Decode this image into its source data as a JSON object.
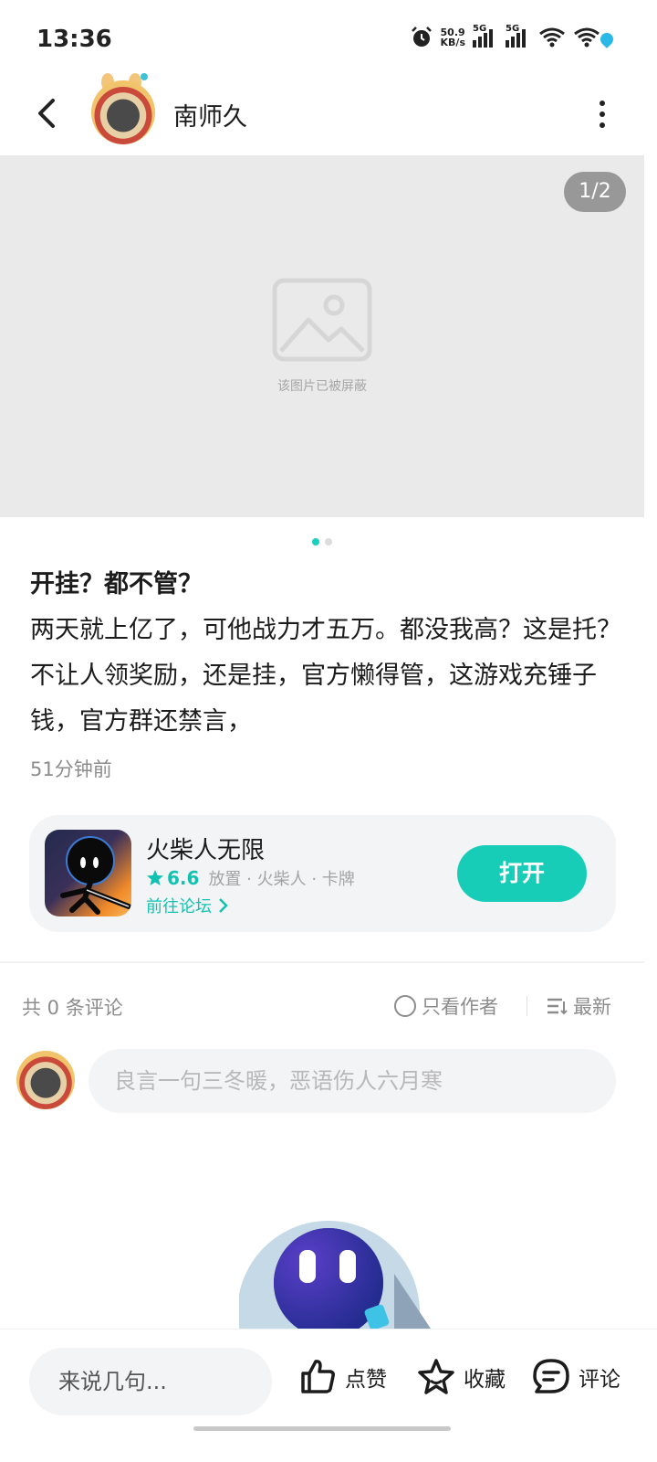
{
  "status_bar": {
    "time": "13:36",
    "net_speed_value": "50.9",
    "net_speed_unit": "KB/s",
    "signal1_label": "5G",
    "signal2_label": "5G",
    "icons": [
      "alarm-icon",
      "signal-icon",
      "signal-icon",
      "wifi-icon",
      "wifi-icon",
      "battery-icon"
    ]
  },
  "header": {
    "username": "南师久"
  },
  "gallery": {
    "page_counter": "1/2",
    "blocked_text": "该图片已被屏蔽",
    "current_index": 1,
    "total": 2
  },
  "post": {
    "title": "开挂？都不管？",
    "body": "两天就上亿了，可他战力才五万。都没我高？这是托？不让人领奖励，还是挂，官方懒得管，这游戏充锤子钱，官方群还禁言，",
    "time": "51分钟前"
  },
  "game_card": {
    "name": "火柴人无限",
    "rating": "6.6",
    "tags": "放置 · 火柴人 · 卡牌",
    "forum_link": "前往论坛",
    "open_button": "打开"
  },
  "comments": {
    "count_label": "共 0 条评论",
    "author_only_label": "只看作者",
    "sort_label": "最新",
    "input_placeholder": "良言一句三冬暖，恶语伤人六月寒"
  },
  "bottom_bar": {
    "say_placeholder": "来说几句...",
    "like_label": "点赞",
    "favorite_label": "收藏",
    "comment_label": "评论"
  },
  "colors": {
    "accent": "#18cdb7",
    "accent_text": "#12c2b1",
    "muted_text": "#8c8c8c",
    "card_bg": "#f3f4f6"
  }
}
